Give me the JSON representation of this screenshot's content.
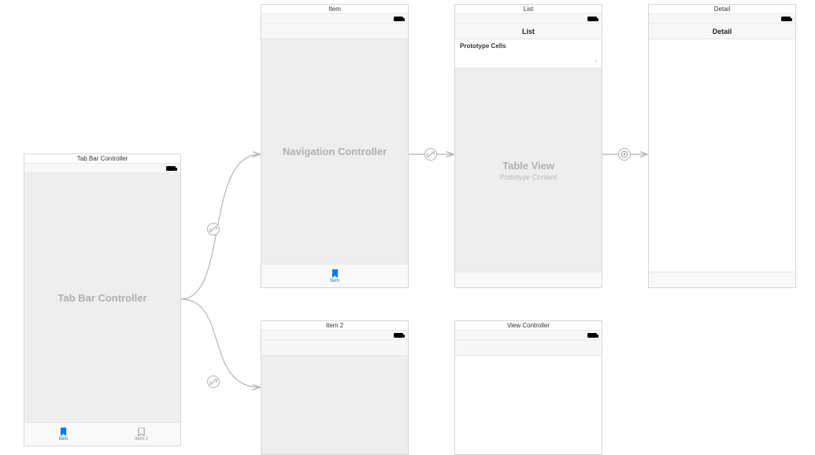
{
  "scenes": {
    "tabbar": {
      "title": "Tab Bar Controller",
      "placeholder": "Tab Bar Controller",
      "tabs": [
        {
          "label": "Item",
          "active": true
        },
        {
          "label": "Item 2",
          "active": false
        }
      ]
    },
    "item": {
      "title": "Item",
      "placeholder": "Navigation Controller",
      "tab_label": "Item"
    },
    "list": {
      "title": "List",
      "nav_title": "List",
      "proto_header": "Prototype Cells",
      "tv_placeholder": "Table View",
      "tv_sub": "Prototype Content"
    },
    "detail": {
      "title": "Detail",
      "nav_title": "Detail"
    },
    "item2": {
      "title": "Item 2"
    },
    "vc2": {
      "title": "View Controller"
    }
  },
  "segues": {
    "tab_to_item": "link-icon",
    "tab_to_item2": "link-icon",
    "item_to_list": "link-icon",
    "list_to_detail": "target-icon"
  }
}
